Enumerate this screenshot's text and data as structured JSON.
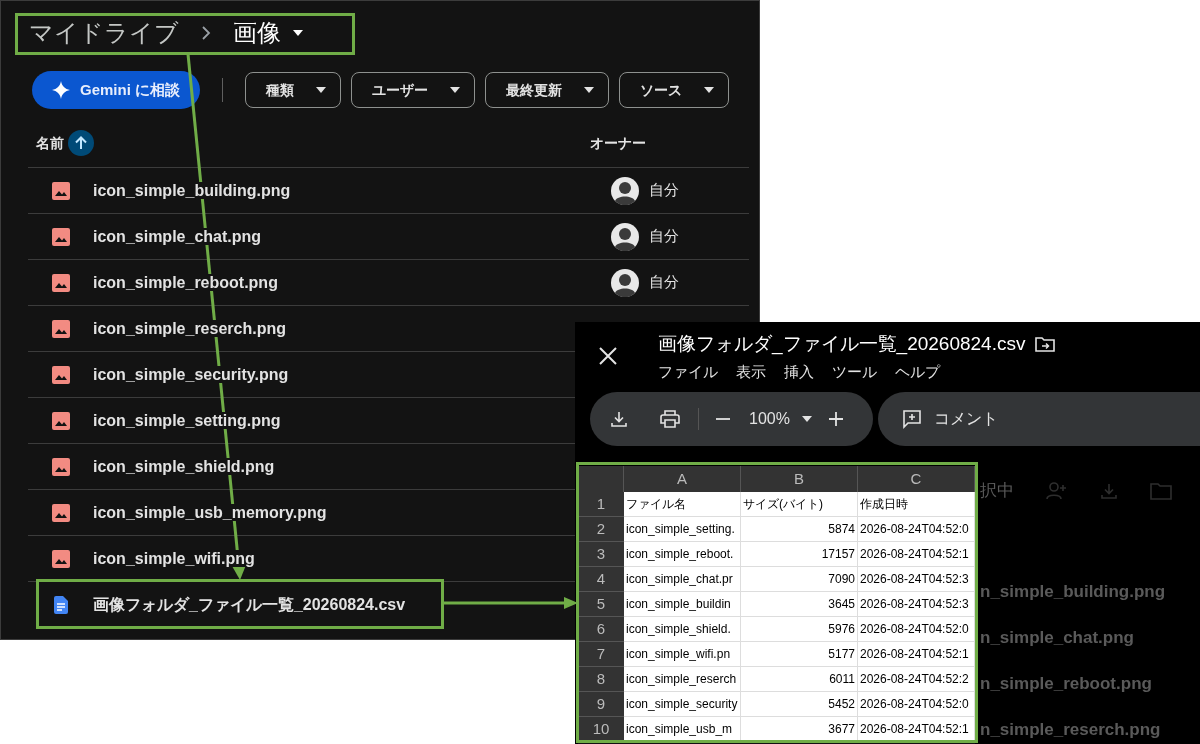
{
  "drive": {
    "breadcrumb": [
      {
        "label": "マイドライブ",
        "current": false
      },
      {
        "label": "画像",
        "current": true
      }
    ],
    "gemini_button": "Gemini に相談",
    "filters": [
      "種類",
      "ユーザー",
      "最終更新",
      "ソース"
    ],
    "columns": {
      "name": "名前",
      "owner": "オーナー"
    },
    "files": [
      {
        "name": "icon_simple_building.png",
        "kind": "image",
        "owner": "自分"
      },
      {
        "name": "icon_simple_chat.png",
        "kind": "image",
        "owner": "自分"
      },
      {
        "name": "icon_simple_reboot.png",
        "kind": "image",
        "owner": "自分"
      },
      {
        "name": "icon_simple_reserch.png",
        "kind": "image"
      },
      {
        "name": "icon_simple_security.png",
        "kind": "image"
      },
      {
        "name": "icon_simple_setting.png",
        "kind": "image"
      },
      {
        "name": "icon_simple_shield.png",
        "kind": "image"
      },
      {
        "name": "icon_simple_usb_memory.png",
        "kind": "image"
      },
      {
        "name": "icon_simple_wifi.png",
        "kind": "image"
      },
      {
        "name": "画像フォルダ_ファイル一覧_20260824.csv",
        "kind": "doc"
      }
    ]
  },
  "preview": {
    "title": "画像フォルダ_ファイル一覧_20260824.csv",
    "menu": [
      "ファイル",
      "表示",
      "挿入",
      "ツール",
      "ヘルプ"
    ],
    "zoom": "100%",
    "comment": "コメント",
    "sheet": {
      "columns": [
        "A",
        "B",
        "C"
      ],
      "rows": [
        {
          "number": "1",
          "cells": [
            "ファイル名",
            "サイズ(バイト)",
            "作成日時"
          ]
        },
        {
          "number": "2",
          "cells": [
            "icon_simple_setting.",
            "5874",
            "2026-08-24T04:52:0"
          ]
        },
        {
          "number": "3",
          "cells": [
            "icon_simple_reboot.",
            "17157",
            "2026-08-24T04:52:1"
          ]
        },
        {
          "number": "4",
          "cells": [
            "icon_simple_chat.pr",
            "7090",
            "2026-08-24T04:52:3"
          ]
        },
        {
          "number": "5",
          "cells": [
            "icon_simple_buildin",
            "3645",
            "2026-08-24T04:52:3"
          ]
        },
        {
          "number": "6",
          "cells": [
            "icon_simple_shield.",
            "5976",
            "2026-08-24T04:52:0"
          ]
        },
        {
          "number": "7",
          "cells": [
            "icon_simple_wifi.pn",
            "5177",
            "2026-08-24T04:52:1"
          ]
        },
        {
          "number": "8",
          "cells": [
            "icon_simple_reserch",
            "6011",
            "2026-08-24T04:52:2"
          ]
        },
        {
          "number": "9",
          "cells": [
            "icon_simple_security",
            "5452",
            "2026-08-24T04:52:0"
          ]
        },
        {
          "number": "10",
          "cells": [
            "icon_simple_usb_m",
            "3677",
            "2026-08-24T04:52:1"
          ]
        }
      ]
    },
    "backdrop": {
      "status": "択中",
      "files": [
        "n_simple_building.png",
        "n_simple_chat.png",
        "n_simple_reboot.png",
        "n_simple_reserch.png"
      ]
    }
  }
}
